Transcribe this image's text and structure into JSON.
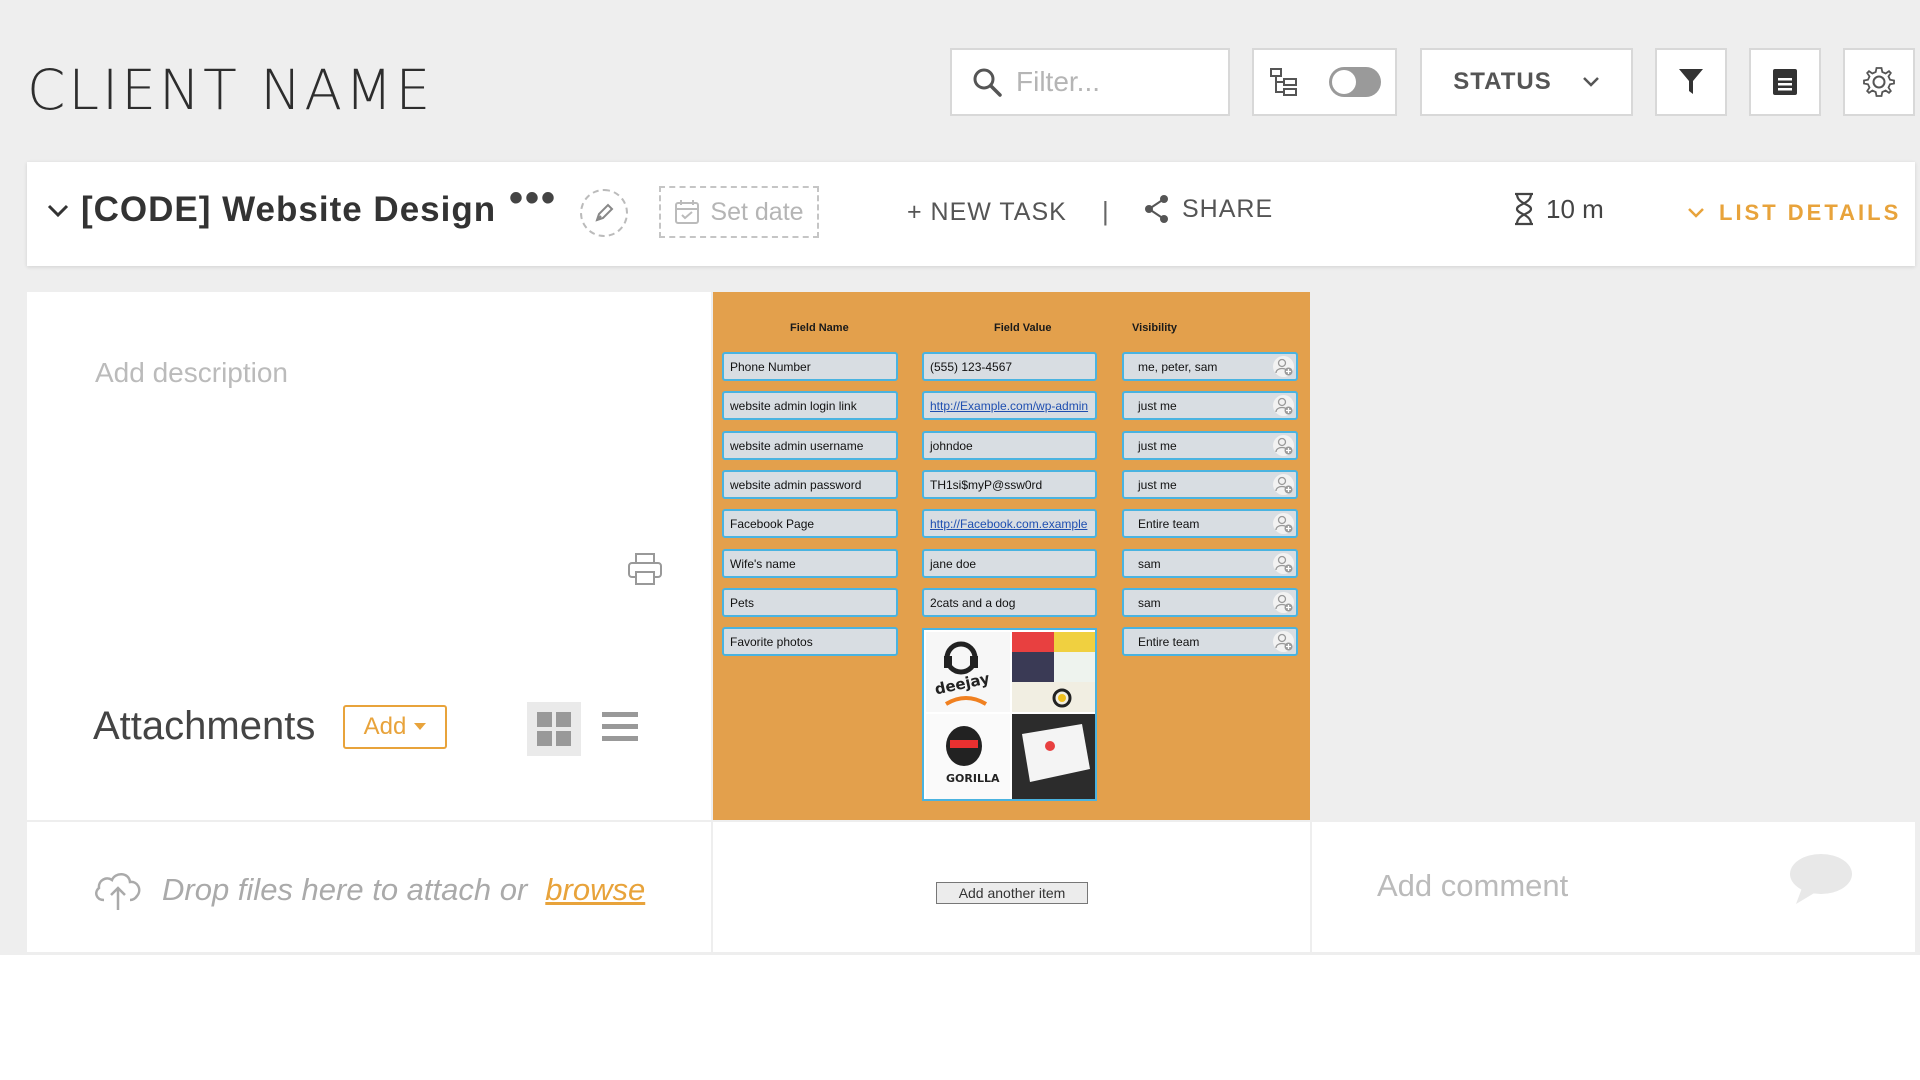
{
  "header": {
    "title": "CLIENT NAME",
    "filter_placeholder": "Filter...",
    "status_label": "STATUS"
  },
  "list_bar": {
    "title": "[CODE] Website Design",
    "more": "•••",
    "set_date": "Set date",
    "new_task": "+ NEW TASK",
    "separator": "|",
    "share": "SHARE",
    "time": "10 m",
    "list_details": "LIST DETAILS"
  },
  "left_panel": {
    "add_description": "Add description",
    "attachments_title": "Attachments",
    "add_label": "Add",
    "drop_text": "Drop files here to attach or",
    "browse": "browse"
  },
  "fields_table": {
    "headers": [
      "Field Name",
      "Field Value",
      "Visibility"
    ],
    "rows": [
      {
        "name": "Phone Number",
        "value": "(555) 123-4567",
        "visibility": "me, peter, sam",
        "link": false
      },
      {
        "name": "website admin login link",
        "value": "http://Example.com/wp-admin",
        "visibility": "just me",
        "link": true
      },
      {
        "name": "website admin username",
        "value": "johndoe",
        "visibility": "just me",
        "link": false
      },
      {
        "name": "website admin password",
        "value": "TH1si$myP@ssw0rd",
        "visibility": "just me",
        "link": false
      },
      {
        "name": "Facebook Page",
        "value": "http://Facebook.com.example",
        "visibility": "Entire team",
        "link": true
      },
      {
        "name": "Wife's name",
        "value": "jane doe",
        "visibility": "sam",
        "link": false
      },
      {
        "name": "Pets",
        "value": "2cats and a dog",
        "visibility": "sam",
        "link": false
      },
      {
        "name": "Favorite photos",
        "value": "",
        "visibility": "Entire team",
        "link": false
      }
    ],
    "photo_labels": {
      "deejay": "deejay",
      "gorilla": "GORILLA"
    },
    "add_another": "Add another item"
  },
  "right_panel": {
    "add_comment": "Add comment"
  },
  "colors": {
    "accent": "#e8a33b",
    "orange_panel": "#e3a04c",
    "cell_border": "#4ab3e0"
  }
}
